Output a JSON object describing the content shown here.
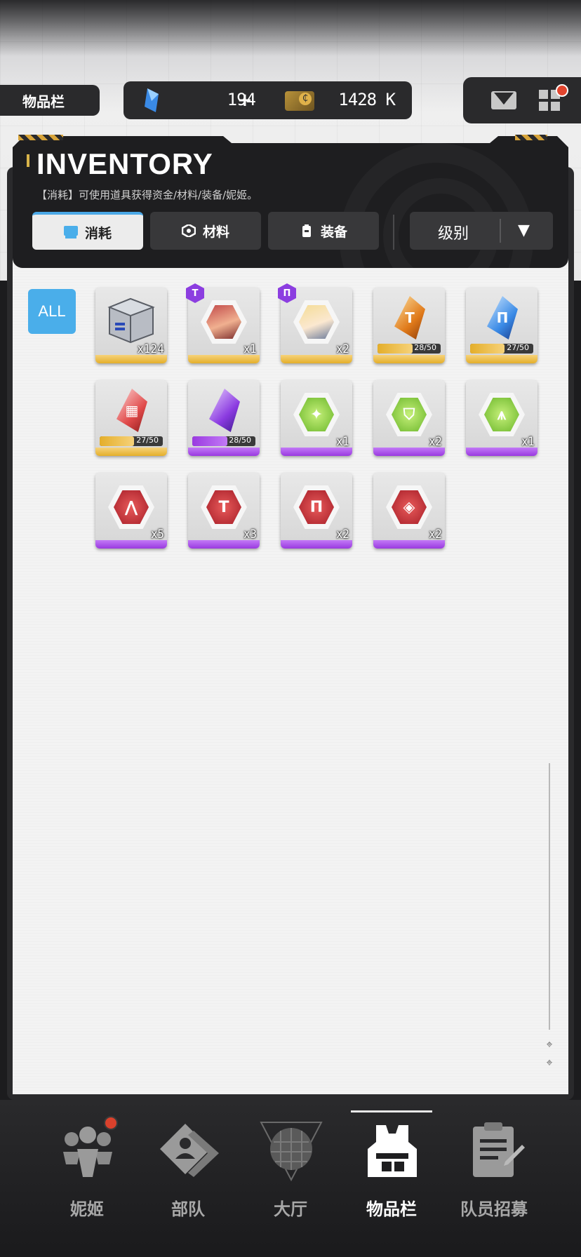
{
  "header": {
    "page_tag": "物品栏",
    "gems": "194",
    "gems_plus": "+",
    "credits": "1428 K"
  },
  "panel": {
    "title": "INVENTORY",
    "subtitle": "【消耗】可使用道具获得资金/材料/装备/妮姬。"
  },
  "tabs": [
    {
      "label": "消耗",
      "active": true
    },
    {
      "label": "材料",
      "active": false
    },
    {
      "label": "装备",
      "active": false
    }
  ],
  "sort": {
    "label": "级别",
    "arrow": "▼"
  },
  "filter": {
    "all_label": "ALL"
  },
  "items": [
    {
      "qty": "x124",
      "rarity": "gold",
      "icon": "supply-box-icon"
    },
    {
      "qty": "x1",
      "rarity": "gold",
      "icon": "nikke-portrait-red-icon",
      "badge": "T"
    },
    {
      "qty": "x2",
      "rarity": "gold",
      "icon": "nikke-portrait-blonde-icon",
      "badge": "Π"
    },
    {
      "progress": "28/50",
      "progress_value": 0.56,
      "rarity": "gold",
      "icon": "orange-shard-icon",
      "glyph": "T"
    },
    {
      "progress": "27/50",
      "progress_value": 0.54,
      "rarity": "gold",
      "icon": "blue-shard-icon",
      "glyph": "Π"
    },
    {
      "progress": "27/50",
      "progress_value": 0.54,
      "rarity": "gold",
      "icon": "red-shard-icon",
      "glyph": "▦"
    },
    {
      "progress": "28/50",
      "progress_value": 0.56,
      "rarity": "purple",
      "icon": "purple-shard-icon",
      "glyph": ""
    },
    {
      "qty": "x1",
      "rarity": "purple",
      "icon": "green-hex-star-icon",
      "glyph": "✦"
    },
    {
      "qty": "x2",
      "rarity": "purple",
      "icon": "green-hex-shield-icon",
      "glyph": "⛉"
    },
    {
      "qty": "x1",
      "rarity": "purple",
      "icon": "green-hex-arrow-icon",
      "glyph": "⩚"
    },
    {
      "qty": "x5",
      "rarity": "purple",
      "icon": "red-hex-arrow-icon",
      "glyph": "⋀"
    },
    {
      "qty": "x3",
      "rarity": "purple",
      "icon": "red-hex-t-icon",
      "glyph": "T"
    },
    {
      "qty": "x2",
      "rarity": "purple",
      "icon": "red-hex-pi-icon",
      "glyph": "Π"
    },
    {
      "qty": "x2",
      "rarity": "purple",
      "icon": "red-hex-grid-icon",
      "glyph": "◈"
    }
  ],
  "nav": [
    {
      "label": "妮姬",
      "icon": "nikke-group-icon",
      "notify": true
    },
    {
      "label": "部队",
      "icon": "squad-icon"
    },
    {
      "label": "大厅",
      "icon": "lobby-globe-icon"
    },
    {
      "label": "物品栏",
      "icon": "inventory-vest-icon",
      "active": true
    },
    {
      "label": "队员招募",
      "icon": "recruit-clipboard-icon"
    }
  ],
  "colors": {
    "accent_blue": "#4aaeea",
    "gold": "#e4ae2a",
    "purple": "#9a3ae0",
    "notify_red": "#d9412c"
  }
}
